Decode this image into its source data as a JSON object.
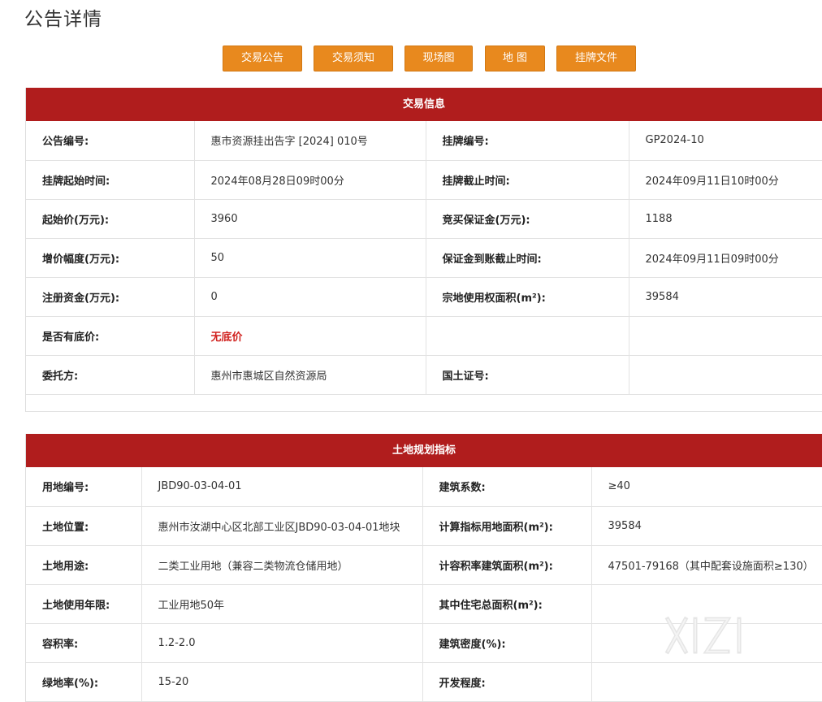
{
  "page": {
    "title": "公告详情"
  },
  "nav_buttons": [
    "交易公告",
    "交易须知",
    "现场图",
    "地 图",
    "挂牌文件"
  ],
  "trade_info": {
    "header": "交易信息",
    "rows": [
      {
        "l1": "公告编号:",
        "v1": "惠市资源挂出告字 [2024] 010号",
        "l2": "挂牌编号:",
        "v2": "GP2024-10"
      },
      {
        "l1": "挂牌起始时间:",
        "v1": "2024年08月28日09时00分",
        "l2": "挂牌截止时间:",
        "v2": "2024年09月11日10时00分"
      },
      {
        "l1": "起始价(万元):",
        "v1": "3960",
        "l2": "竞买保证金(万元):",
        "v2": "1188"
      },
      {
        "l1": "增价幅度(万元):",
        "v1": "50",
        "l2": "保证金到账截止时间:",
        "v2": "2024年09月11日09时00分"
      },
      {
        "l1": "注册资金(万元):",
        "v1": "0",
        "l2": "宗地使用权面积(m²):",
        "v2": "39584"
      },
      {
        "l1": "是否有底价:",
        "v1": "无底价",
        "l2": "",
        "v2": ""
      },
      {
        "l1": "委托方:",
        "v1": "惠州市惠城区自然资源局",
        "l2": "国土证号:",
        "v2": ""
      }
    ]
  },
  "land_plan": {
    "header": "土地规划指标",
    "rows": [
      {
        "l1": "用地编号:",
        "v1": "JBD90-03-04-01",
        "l2": "建筑系数:",
        "v2": "≥40"
      },
      {
        "l1": "土地位置:",
        "v1": "惠州市汝湖中心区北部工业区JBD90-03-04-01地块",
        "l2": "计算指标用地面积(m²):",
        "v2": "39584"
      },
      {
        "l1": "土地用途:",
        "v1": "二类工业用地（兼容二类物流仓储用地）",
        "l2": "计容积率建筑面积(m²):",
        "v2": "47501-79168（其中配套设施面积≥130）"
      },
      {
        "l1": "土地使用年限:",
        "v1": "工业用地50年",
        "l2": "其中住宅总面积(m²):",
        "v2": ""
      },
      {
        "l1": "容积率:",
        "v1": "1.2-2.0",
        "l2": "建筑密度(%):",
        "v2": ""
      },
      {
        "l1": "绿地率(%):",
        "v1": "15-20",
        "l2": "开发程度:",
        "v2": ""
      }
    ]
  },
  "colors": {
    "accent_button": "#e8891e",
    "section_header": "#b01d1d",
    "highlight_text": "#d0201d"
  }
}
